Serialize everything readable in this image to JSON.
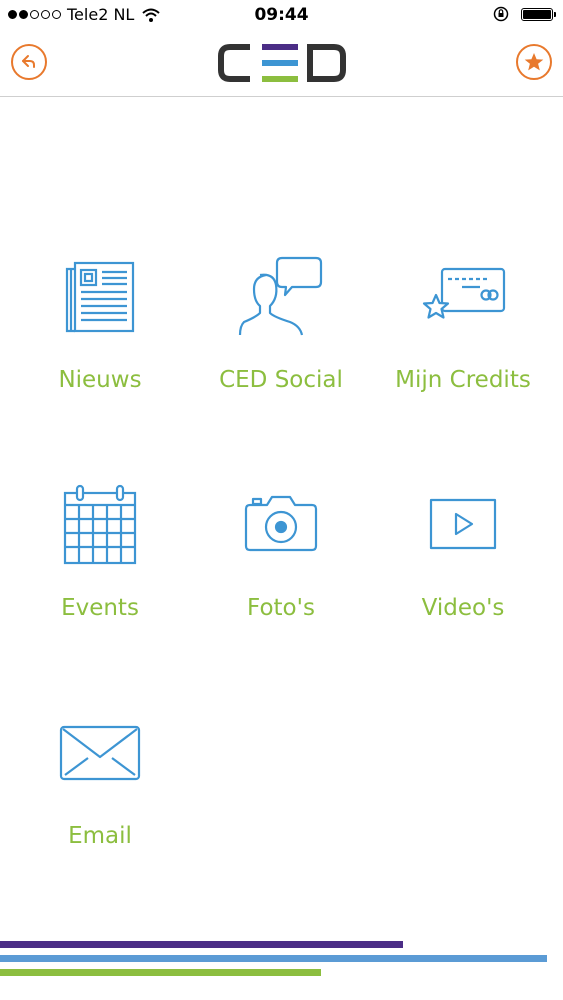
{
  "status_bar": {
    "carrier": "Tele2 NL",
    "time": "09:44",
    "signal_bars_filled": 2,
    "signal_bars_total": 5
  },
  "nav": {
    "back_icon": "back-arrow-icon",
    "favorite_icon": "star-icon",
    "logo_text": "CED"
  },
  "menu": [
    {
      "label": "Nieuws",
      "icon": "newspaper-icon"
    },
    {
      "label": "CED Social",
      "icon": "social-chat-icon"
    },
    {
      "label": "Mijn Credits",
      "icon": "credit-card-star-icon"
    },
    {
      "label": "Events",
      "icon": "calendar-icon"
    },
    {
      "label": "Foto's",
      "icon": "camera-icon"
    },
    {
      "label": "Video's",
      "icon": "video-play-icon"
    },
    {
      "label": "Email",
      "icon": "envelope-icon"
    }
  ],
  "colors": {
    "accent_orange": "#e8792d",
    "icon_blue": "#3d95d3",
    "label_green": "#8cbe3f",
    "stripe_purple": "#4b2d86",
    "stripe_blue": "#5b9bd5",
    "stripe_green": "#8cbe3f"
  }
}
